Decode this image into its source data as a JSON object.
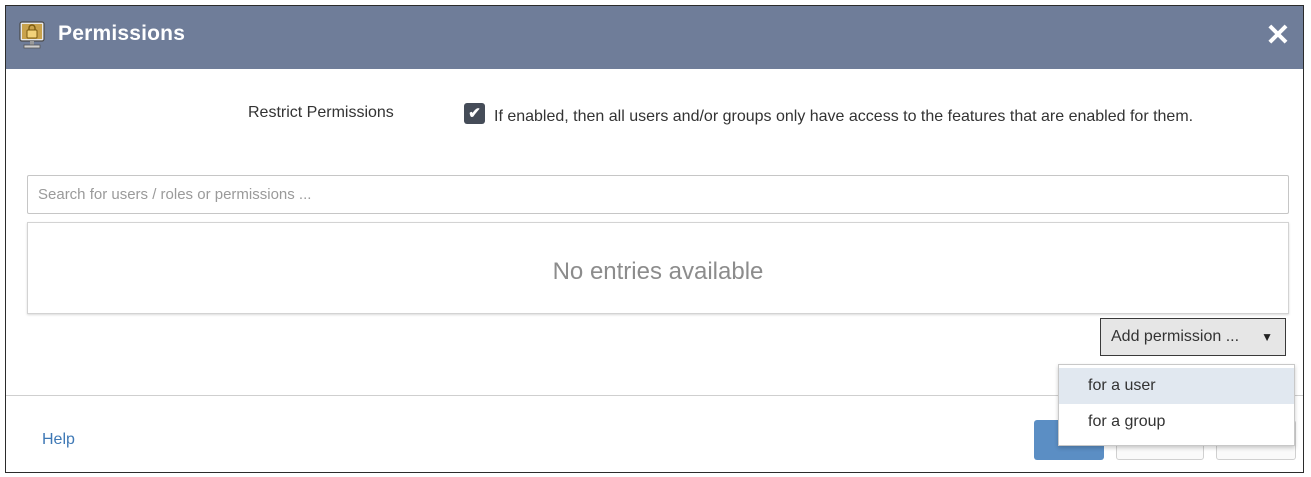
{
  "dialog": {
    "title": "Permissions",
    "title_icon": "lock-monitor-icon",
    "close_icon": "close-icon",
    "close_glyph": "✕"
  },
  "restrict": {
    "label": "Restrict Permissions",
    "checked": true,
    "check_glyph": "✔",
    "description": "If enabled, then all users and/or groups only have access to the features that are enabled for them."
  },
  "search": {
    "placeholder": "Search for users / roles or permissions ...",
    "value": ""
  },
  "entries": {
    "empty_text": "No entries available"
  },
  "add_permission": {
    "label": "Add permission ...",
    "caret": "▼"
  },
  "dropdown": {
    "items": [
      {
        "label": "for a user",
        "highlighted": true
      },
      {
        "label": "for a group",
        "highlighted": false
      }
    ]
  },
  "footer": {
    "help_label": "Help",
    "primary_button_label": "",
    "secondary_button_label": "",
    "tertiary_button_label": ""
  },
  "colors": {
    "titlebar": "#6f7d99",
    "primary": "#5b8ec4",
    "link": "#3e78b5",
    "highlight": "#e1e8f0"
  }
}
